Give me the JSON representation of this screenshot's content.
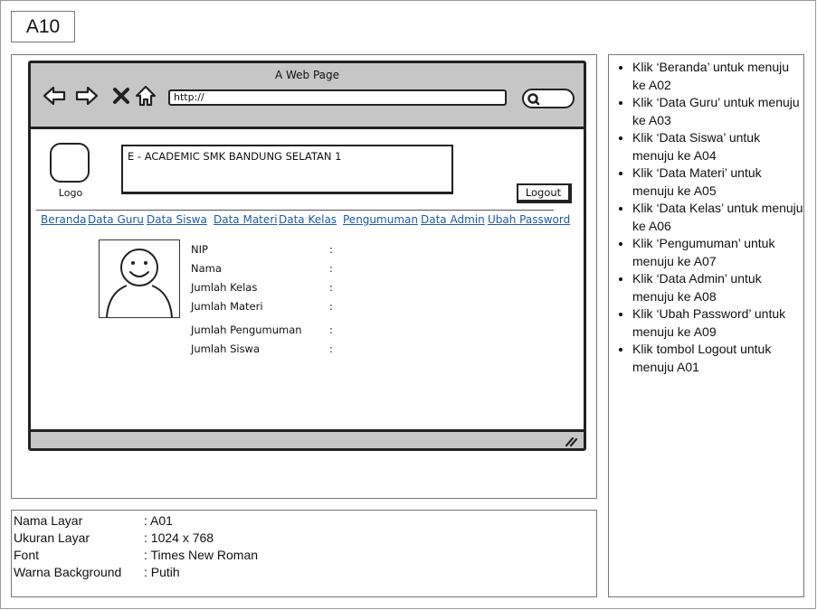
{
  "page_id": "A10",
  "browser": {
    "window_title": "A Web Page",
    "url": "http://"
  },
  "header": {
    "logo_label": "Logo",
    "app_title": "E - ACADEMIC SMK BANDUNG SELATAN 1",
    "logout_label": "Logout"
  },
  "menu": [
    {
      "label": "Beranda"
    },
    {
      "label": "Data Guru"
    },
    {
      "label": "Data Siswa"
    },
    {
      "label": "Data Materi"
    },
    {
      "label": "Data Kelas"
    },
    {
      "label": "Pengumuman"
    },
    {
      "label": "Data Admin"
    },
    {
      "label": "Ubah Password"
    }
  ],
  "profile": {
    "fields": [
      {
        "label": "NIP",
        "sep": ":"
      },
      {
        "label": "Nama",
        "sep": ":"
      },
      {
        "label": "Jumlah Kelas",
        "sep": ":"
      },
      {
        "label": "Jumlah Materi",
        "sep": ":"
      },
      {
        "label": "Jumlah Pengumuman",
        "sep": ":"
      },
      {
        "label": "Jumlah Siswa",
        "sep": ":"
      }
    ]
  },
  "notes": [
    "Klik ‘Beranda’ untuk menuju ke A02",
    "Klik ‘Data Guru’ untuk menuju ke A03",
    "Klik ‘Data Siswa’ untuk menuju ke A04",
    "Klik ‘Data Materi’ untuk menuju ke A05",
    "Klik ‘Data Kelas’ untuk menuju ke A06",
    "Klik ‘Pengumuman’ untuk menuju ke A07",
    "Klik ‘Data Admin’ untuk menuju ke A08",
    "Klik ‘Ubah Password’ untuk menuju ke A09",
    "Klik tombol Logout untuk menuju A01"
  ],
  "info": [
    {
      "label": "Nama Layar",
      "value": ": A01"
    },
    {
      "label": "Ukuran Layar",
      "value": ": 1024 x 768"
    },
    {
      "label": "Font",
      "value": ": Times New Roman"
    },
    {
      "label": "Warna Background",
      "value": ": Putih"
    }
  ],
  "colors": {
    "menu_link": "#1e5aa8",
    "chrome_gray": "#c6c6c6",
    "stroke": "#222222"
  }
}
